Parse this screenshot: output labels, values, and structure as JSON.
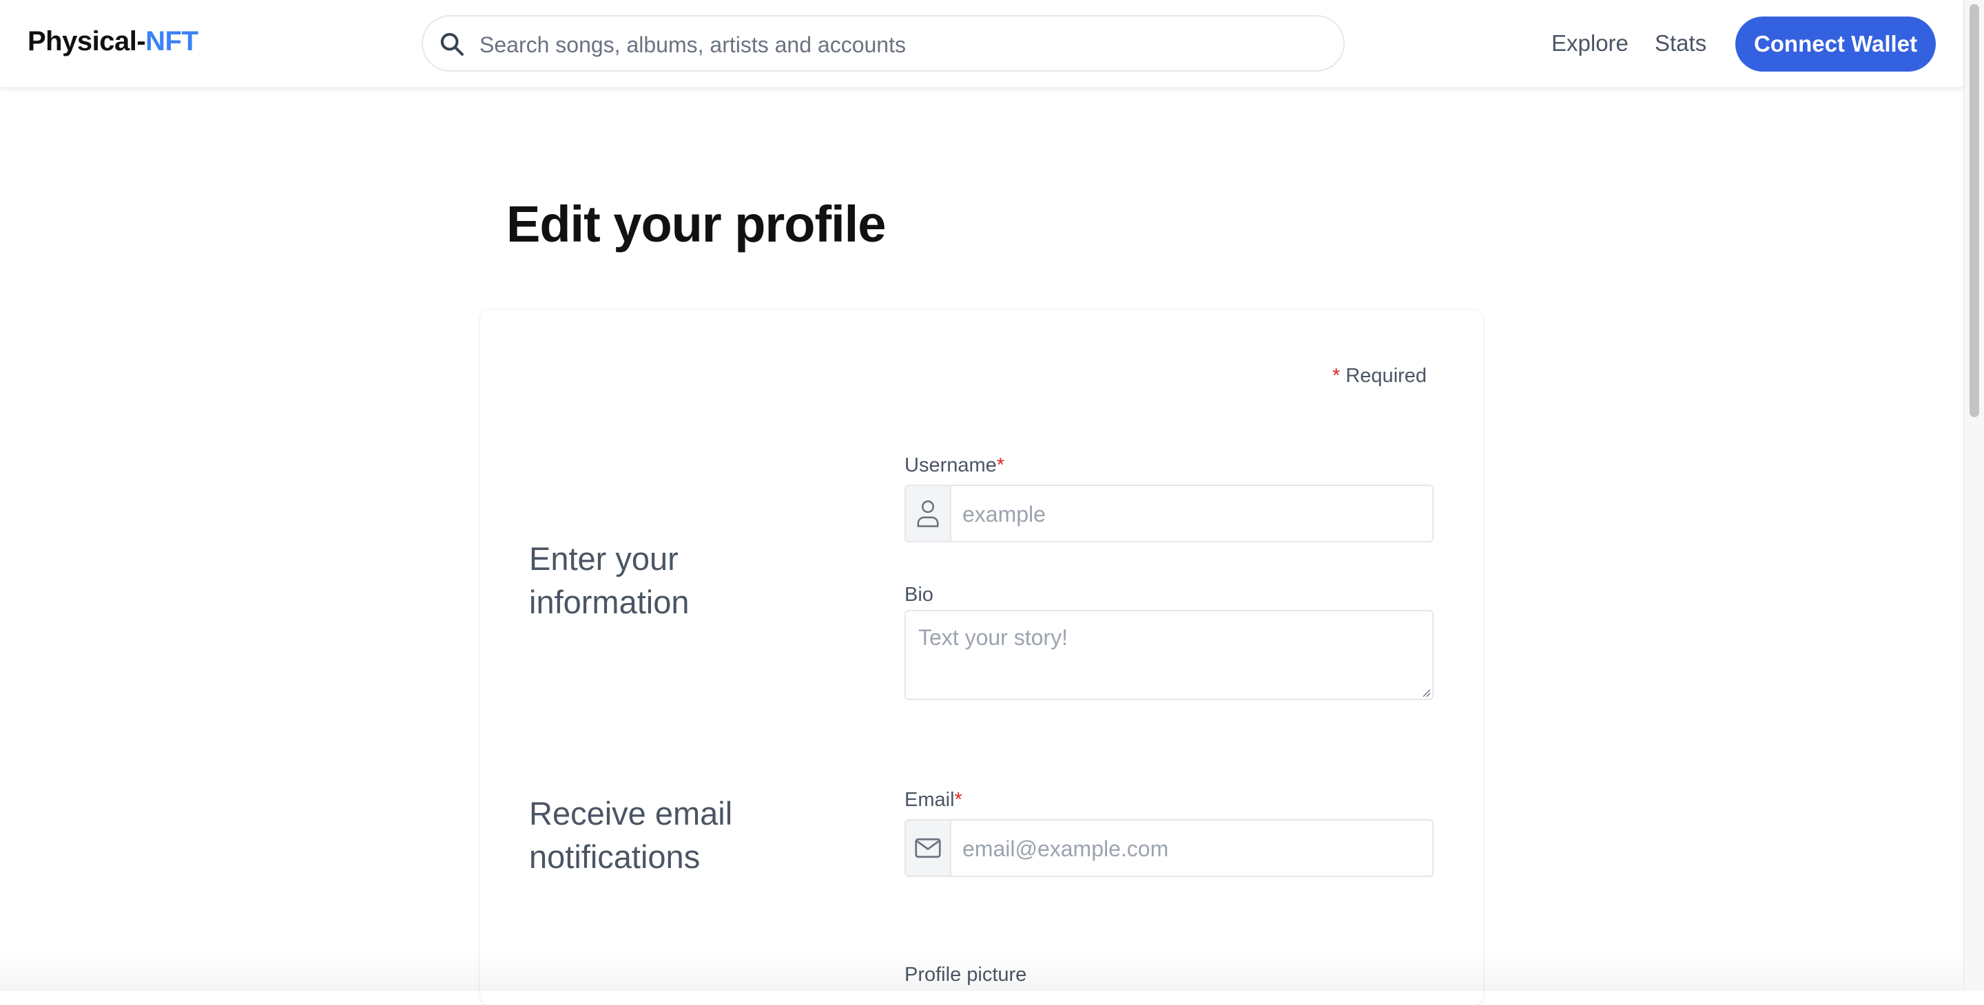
{
  "header": {
    "logo_primary": "Physical-",
    "logo_accent": "NFT",
    "search_placeholder": "Search songs, albums, artists and accounts",
    "nav": {
      "explore": "Explore",
      "stats": "Stats"
    },
    "connect_wallet_label": "Connect Wallet"
  },
  "page": {
    "title": "Edit your profile",
    "required_asterisk": "*",
    "required_label": "Required"
  },
  "sections": {
    "info_title": "Enter your information",
    "email_title": "Receive email notifications"
  },
  "fields": {
    "username": {
      "label": "Username",
      "required_mark": "*",
      "placeholder": "example",
      "icon": "user-icon"
    },
    "bio": {
      "label": "Bio",
      "placeholder": "Text your story!"
    },
    "email": {
      "label": "Email",
      "required_mark": "*",
      "placeholder": "email@example.com",
      "icon": "mail-icon"
    },
    "profile_picture": {
      "label": "Profile picture"
    }
  },
  "colors": {
    "accent": "#3b82f6",
    "button": "#3461e0",
    "required": "#dc2626",
    "muted_text": "#4b5563"
  }
}
